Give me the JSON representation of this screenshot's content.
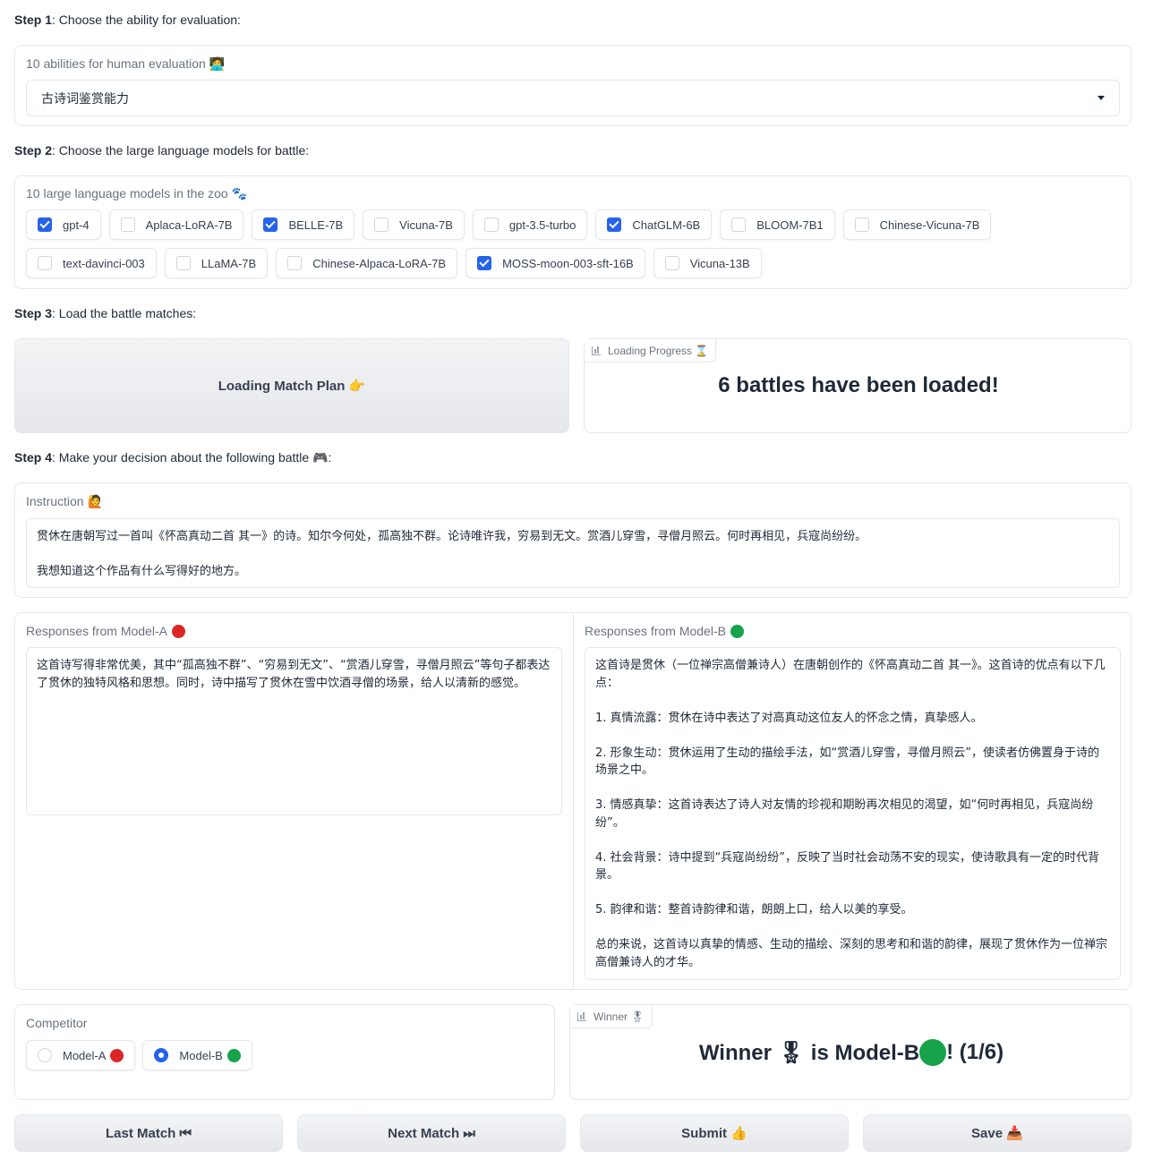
{
  "step1": {
    "prefix": "Step 1",
    "text": ": Choose the ability for evaluation:"
  },
  "abilities": {
    "label": "10 abilities for human evaluation 🧑‍💻",
    "selected": "古诗词鉴赏能力"
  },
  "step2": {
    "prefix": "Step 2",
    "text": ": Choose the large language models for battle:"
  },
  "models": {
    "label": "10 large language models in the zoo 🐾",
    "items": [
      {
        "label": "gpt-4",
        "checked": true
      },
      {
        "label": "Aplaca-LoRA-7B",
        "checked": false
      },
      {
        "label": "BELLE-7B",
        "checked": true
      },
      {
        "label": "Vicuna-7B",
        "checked": false
      },
      {
        "label": "gpt-3.5-turbo",
        "checked": false
      },
      {
        "label": "ChatGLM-6B",
        "checked": true
      },
      {
        "label": "BLOOM-7B1",
        "checked": false
      },
      {
        "label": "Chinese-Vicuna-7B",
        "checked": false
      },
      {
        "label": "text-davinci-003",
        "checked": false
      },
      {
        "label": "LLaMA-7B",
        "checked": false
      },
      {
        "label": "Chinese-Alpaca-LoRA-7B",
        "checked": false
      },
      {
        "label": "MOSS-moon-003-sft-16B",
        "checked": true
      },
      {
        "label": "Vicuna-13B",
        "checked": false
      }
    ]
  },
  "step3": {
    "prefix": "Step 3",
    "text": ": Load the battle matches:"
  },
  "load_button": "Loading Match Plan 👉",
  "progress": {
    "label": "Loading Progress ⌛",
    "text": "6 battles have been loaded!"
  },
  "step4": {
    "prefix": "Step 4",
    "text": ": Make your decision about the following battle 🎮:"
  },
  "instruction": {
    "label": "Instruction 🙋",
    "text": "贯休在唐朝写过一首叫《怀高真动二首 其一》的诗。知尔今何处，孤高独不群。论诗唯许我，穷易到无文。赏酒儿穿雪，寻僧月照云。何时再相见，兵寇尚纷纷。\n\n我想知道这个作品有什么写得好的地方。"
  },
  "model_a": {
    "label": "Responses from Model-A",
    "text": "这首诗写得非常优美，其中“孤高独不群”、“穷易到无文”、“赏酒儿穿雪，寻僧月照云”等句子都表达了贯休的独特风格和思想。同时，诗中描写了贯休在雪中饮酒寻僧的场景，给人以清新的感觉。"
  },
  "model_b": {
    "label": "Responses from Model-B",
    "text": "这首诗是贯休（一位禅宗高僧兼诗人）在唐朝创作的《怀高真动二首 其一》。这首诗的优点有以下几点：\n\n1. 真情流露：贯休在诗中表达了对高真动这位友人的怀念之情，真挚感人。\n\n2. 形象生动：贯休运用了生动的描绘手法，如“赏酒儿穿雪，寻僧月照云”，使读者仿佛置身于诗的场景之中。\n\n3. 情感真挚：这首诗表达了诗人对友情的珍视和期盼再次相见的渴望，如“何时再相见，兵寇尚纷纷”。\n\n4. 社会背景：诗中提到“兵寇尚纷纷”，反映了当时社会动荡不安的现实，使诗歌具有一定的时代背景。\n\n5. 韵律和谐：整首诗韵律和谐，朗朗上口，给人以美的享受。\n\n总的来说，这首诗以真挚的情感、生动的描绘、深刻的思考和和谐的韵律，展现了贯休作为一位禅宗高僧兼诗人的才华。"
  },
  "competitor": {
    "label": "Competitor",
    "options": [
      {
        "label": "Model-A",
        "selected": false
      },
      {
        "label": "Model-B",
        "selected": true
      }
    ]
  },
  "winner": {
    "label": "Winner 🎖",
    "pre": "Winner 🎖 is Model-B ",
    "post": "! (1/6)"
  },
  "buttons": {
    "last": "Last Match ⏮",
    "next": "Next Match ⏭",
    "submit": "Submit 👍",
    "save": "Save 📥"
  },
  "colors": {
    "accent": "#2563eb",
    "model_a": "#dc2626",
    "model_b": "#16a34a"
  }
}
